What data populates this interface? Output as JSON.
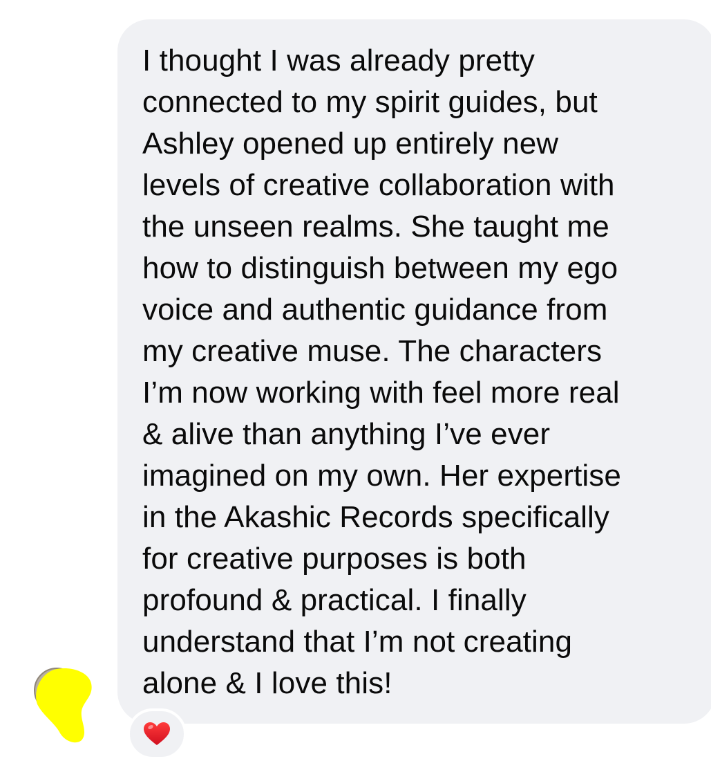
{
  "message": {
    "lines": [
      "I thought I was already pretty",
      "connected to my spirit guides, but",
      "Ashley opened up entirely new",
      "levels of creative collaboration with",
      "the unseen realms. She taught me",
      "how to distinguish between my ego",
      "voice and authentic guidance from",
      "my creative muse. The characters",
      "I’m now working with feel more real",
      "& alive than anything I’ve ever",
      "imagined on my own. Her expertise",
      "in the Akashic Records specifically",
      "for creative purposes is both",
      "profound & practical. I finally",
      "understand that I’m not creating",
      "alone & I love this!"
    ],
    "reaction_icon": "heart-icon",
    "bubble_color": "#f0f1f4",
    "avatar_cover_color": "#ffff00"
  }
}
